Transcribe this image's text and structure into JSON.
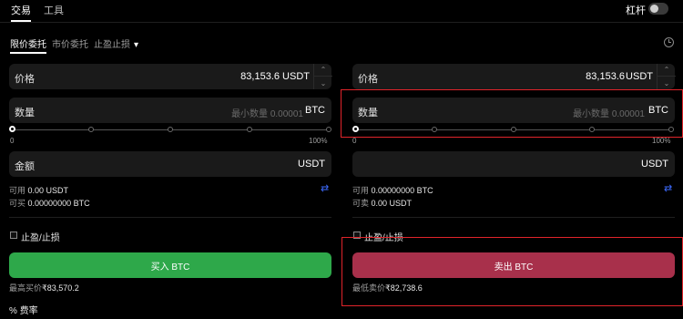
{
  "top_tabs": [
    {
      "label": "交易"
    },
    {
      "label": "工具"
    }
  ],
  "leverage_label": "杠杆",
  "order_tabs": [
    {
      "label": "限价委托"
    },
    {
      "label": "市价委托"
    },
    {
      "label": "止盈止损"
    }
  ],
  "order_tab_dropdown": "⌄",
  "icons": {
    "clock": "clock-icon",
    "swap": "swap-arrows-icon",
    "stepper_up": "chevron-up-icon",
    "stepper_down": "chevron-down-icon"
  },
  "colors": {
    "buy": "#2ea84a",
    "sell": "#a8304b",
    "highlight": "#e0242a",
    "accent": "#3d6bff"
  },
  "buy": {
    "price_label": "价格",
    "price_value": "83,153.6",
    "price_unit": "USDT",
    "qty_label": "数量",
    "qty_placeholder": "最小数量 0.00001",
    "qty_unit": "BTC",
    "slider_min": "0",
    "slider_max": "100%",
    "slider_value": 0,
    "amount_label": "金额",
    "amount_unit": "USDT",
    "available_label": "可用",
    "available_value": "0.00 USDT",
    "can_buy_label": "可买",
    "can_buy_value": "0.00000000 BTC",
    "tpsl_label": "止盈/止损",
    "button_label": "买入 BTC",
    "price_hint_label": "最高买价",
    "price_hint_value": "₹83,570.2",
    "fee_label": "费率",
    "fee_icon": "%"
  },
  "sell": {
    "price_label": "价格",
    "price_value": "83,153.6",
    "price_unit": "USDT",
    "qty_label": "数量",
    "qty_placeholder": "最小数量 0.00001",
    "qty_unit": "BTC",
    "slider_min": "0",
    "slider_max": "100%",
    "slider_value": 0,
    "amount_unit": "USDT",
    "available_label": "可用",
    "available_value": "0.00000000 BTC",
    "can_sell_label": "可卖",
    "can_sell_value": "0.00 USDT",
    "tpsl_label": "止盈/止损",
    "button_label": "卖出 BTC",
    "price_hint_label": "最低卖价",
    "price_hint_value": "₹82,738.6"
  }
}
